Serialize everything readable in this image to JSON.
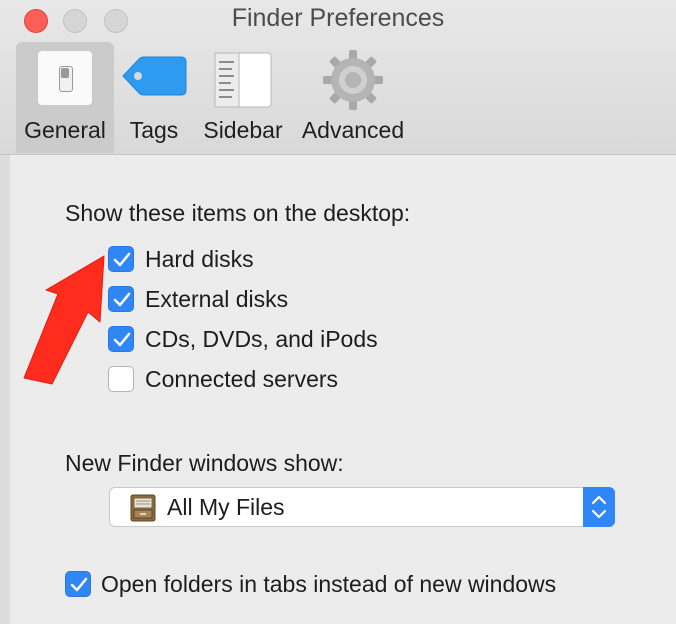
{
  "window": {
    "title": "Finder Preferences"
  },
  "toolbar": {
    "tabs": [
      {
        "label": "General",
        "icon": "general-switch-icon",
        "selected": true
      },
      {
        "label": "Tags",
        "icon": "tag-icon",
        "selected": false
      },
      {
        "label": "Sidebar",
        "icon": "sidebar-icon",
        "selected": false
      },
      {
        "label": "Advanced",
        "icon": "gear-icon",
        "selected": false
      }
    ]
  },
  "desktop_section": {
    "heading": "Show these items on the desktop:",
    "items": [
      {
        "label": "Hard disks",
        "checked": true
      },
      {
        "label": "External disks",
        "checked": true
      },
      {
        "label": "CDs, DVDs, and iPods",
        "checked": true
      },
      {
        "label": "Connected servers",
        "checked": false
      }
    ]
  },
  "new_window_section": {
    "heading": "New Finder windows show:",
    "selected_value": "All My Files",
    "icon": "file-cabinet-icon"
  },
  "open_folders_tabs": {
    "label": "Open folders in tabs instead of new windows",
    "checked": true
  },
  "colors": {
    "accent": "#2e86f7",
    "annotation_arrow": "#ff2b1c"
  }
}
